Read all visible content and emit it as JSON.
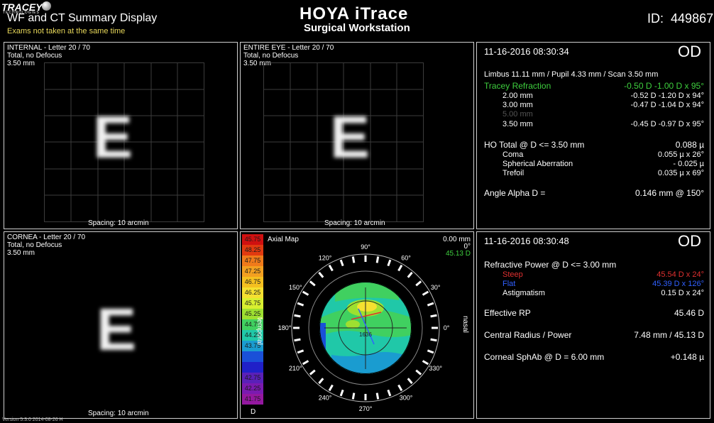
{
  "header": {
    "logo_text": "TRACEY",
    "logo_sub": "TECHNOLOGIES",
    "title": "WF and CT Summary Display",
    "subtitle": "Exams not taken at the same time",
    "brand_line1": "HOYA iTrace",
    "brand_line2": "Surgical Workstation",
    "id_label": "ID:",
    "id_value": "449867"
  },
  "internal": {
    "title": "INTERNAL - Letter 20 / 70",
    "line2": "Total, no Defocus",
    "line3": "3.50 mm",
    "letter": "E",
    "spacing": "Spacing:  10 arcmin"
  },
  "entire_eye": {
    "title": "ENTIRE EYE - Letter 20 / 70",
    "line2": "Total, no Defocus",
    "line3": "3.50 mm",
    "letter": "E",
    "spacing": "Spacing:  10 arcmin"
  },
  "cornea": {
    "title": "CORNEA - Letter 20 / 70",
    "line2": "Total, no Defocus",
    "line3": "3.50 mm",
    "letter": "E",
    "spacing": "Spacing:  10 arcmin"
  },
  "wf_info": {
    "datetime": "11-16-2016  08:30:34",
    "eye": "OD",
    "scan_line": "Limbus 11.11 mm  /  Pupil 4.33 mm  /  Scan 3.50 mm",
    "refraction_label": "Tracey Refraction",
    "refraction_value": "-0.50 D -1.00 D x 95°",
    "rows": [
      {
        "label": "2.00 mm",
        "value": "-0.52 D -1.20 D x 94°",
        "dim": false
      },
      {
        "label": "3.00 mm",
        "value": "-0.47 D -1.04 D x 94°",
        "dim": false
      },
      {
        "label": "5.00 mm",
        "value": "",
        "dim": true
      },
      {
        "label": "3.50 mm",
        "value": "-0.45 D -0.97 D x 95°",
        "dim": false
      }
    ],
    "ho_label": "HO Total @ D <= 3.50 mm",
    "ho_value": "0.088 µ",
    "coma_label": "Coma",
    "coma_value": "0.055 µ x   26°",
    "sphab_label": "Spherical Aberration",
    "sphab_value": "- 0.025 µ",
    "trefoil_label": "Trefoil",
    "trefoil_value": "0.035 µ x   69°",
    "alpha_label": "Angle Alpha D =",
    "alpha_value": "0.146 mm @ 150°"
  },
  "ct_info": {
    "datetime": "11-16-2016  08:30:48",
    "eye": "OD",
    "rp_label": "Refractive Power @ D <= 3.00 mm",
    "steep_label": "Steep",
    "steep_value": "45.54 D x  24°",
    "flat_label": "Flat",
    "flat_value": "45.39 D x 126°",
    "astig_label": "Astigmatism",
    "astig_value": "0.15 D x  24°",
    "erp_label": "Effective RP",
    "erp_value": "45.46 D",
    "cr_label": "Central Radius / Power",
    "cr_value": "7.48 mm / 45.13 D",
    "sphab_label": "Corneal SphAb @ D = 6.00 mm",
    "sphab_value": "+0.148 µ"
  },
  "axial_map": {
    "title": "Axial Map",
    "temporal": "temporal",
    "nasal": "nasal",
    "readout_mm": "0.00 mm",
    "readout_deg": "0°",
    "readout_d": "45.13 D",
    "center_value": "1636",
    "scale_unit": "D",
    "scale": [
      {
        "v": "45.75",
        "c": "#d01010"
      },
      {
        "v": "48.25",
        "c": "#e23a10"
      },
      {
        "v": "47.75",
        "c": "#f07a1a"
      },
      {
        "v": "47.25",
        "c": "#f3a020"
      },
      {
        "v": "46.75",
        "c": "#f5c020"
      },
      {
        "v": "46.25",
        "c": "#f5e030"
      },
      {
        "v": "45.75",
        "c": "#d8ef30"
      },
      {
        "v": "45.25",
        "c": "#9ee030"
      },
      {
        "v": "44.75",
        "c": "#40d060"
      },
      {
        "v": "44.25",
        "c": "#20c8a8"
      },
      {
        "v": "43.75",
        "c": "#1a9cd0"
      },
      {
        "v": "",
        "c": "#1a50d8"
      },
      {
        "v": "",
        "c": "#2020c8"
      },
      {
        "v": "42.75",
        "c": "#5a20b8"
      },
      {
        "v": "42.25",
        "c": "#7a1ab0"
      },
      {
        "v": "41.75",
        "c": "#9418a0"
      }
    ],
    "angles": [
      "90°",
      "60°",
      "30°",
      "0°",
      "330°",
      "300°",
      "270°",
      "240°",
      "210°",
      "180°",
      "150°",
      "120°"
    ]
  },
  "footer": {
    "version": "Version 5.3.0 2014-08-26 H"
  },
  "colors": {
    "green": "#3ecf3e",
    "steep": "#e03030",
    "flat": "#3060ff",
    "dim": "#555555"
  }
}
